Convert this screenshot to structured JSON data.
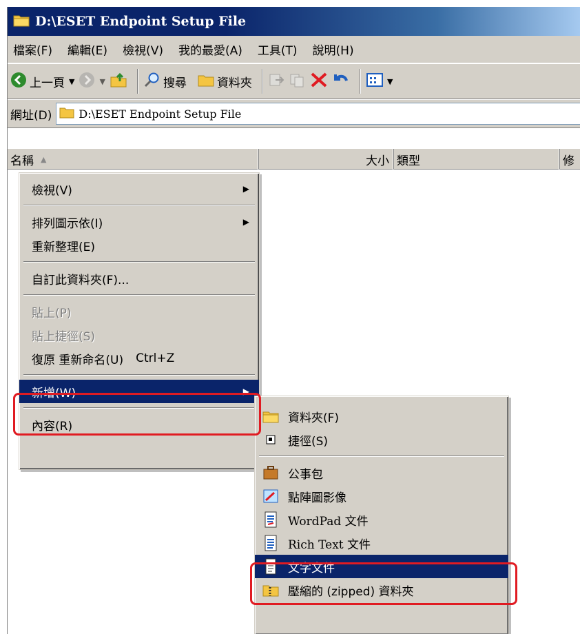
{
  "window": {
    "title": "D:\\ESET Endpoint Setup File"
  },
  "menubar": [
    "檔案(F)",
    "編輯(E)",
    "檢視(V)",
    "我的最愛(A)",
    "工具(T)",
    "說明(H)"
  ],
  "toolbar": {
    "back": "上一頁",
    "search": "搜尋",
    "folders": "資料夾"
  },
  "address": {
    "label": "網址(D)",
    "value": "D:\\ESET Endpoint Setup File"
  },
  "columns": {
    "name": "名稱",
    "size": "大小",
    "type": "類型",
    "modified": "修"
  },
  "context_menu": {
    "view": "檢視(V)",
    "arrange": "排列圖示依(I)",
    "refresh": "重新整理(E)",
    "customize": "自訂此資料夾(F)...",
    "paste": "貼上(P)",
    "paste_shortcut": "貼上捷徑(S)",
    "undo": "復原 重新命名(U)",
    "undo_shortcut": "Ctrl+Z",
    "new": "新增(W)",
    "properties": "內容(R)"
  },
  "new_submenu": {
    "folder": "資料夾(F)",
    "shortcut": "捷徑(S)",
    "briefcase": "公事包",
    "bitmap": "點陣圖影像",
    "wordpad": "WordPad 文件",
    "richtext": "Rich Text 文件",
    "textdoc": "文字文件",
    "zipped": "壓縮的 (zipped) 資料夾"
  },
  "colors": {
    "title_bar": "#0a246a",
    "menu_bg": "#d4d0c8",
    "selection": "#0a246a",
    "highlight": "#e01b22"
  }
}
